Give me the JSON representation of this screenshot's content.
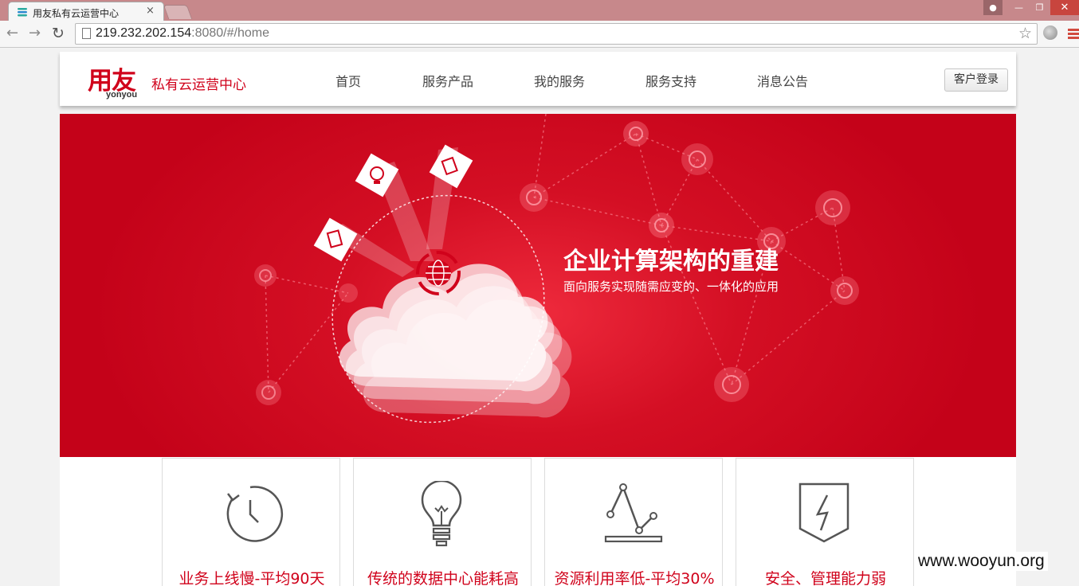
{
  "browser": {
    "tab_title": "用友私有云运营中心",
    "tab_close": "×",
    "url_host": "219.232.202.154",
    "url_rest": ":8080/#/home",
    "icons": {
      "back": "arrow-left-icon",
      "forward": "arrow-right-icon",
      "reload": "reload-icon",
      "star": "star-icon"
    }
  },
  "header": {
    "logo_text": "用友",
    "logo_sub": "yonyou",
    "logo_center": "私有云运营中心",
    "nav": [
      {
        "label": "首页"
      },
      {
        "label": "服务产品"
      },
      {
        "label": "我的服务"
      },
      {
        "label": "服务支持"
      },
      {
        "label": "消息公告"
      }
    ],
    "login_label": "客户登录"
  },
  "banner": {
    "title": "企业计算架构的重建",
    "subtitle": "面向服务实现随需应变的、一体化的应用",
    "accent_color": "#c40219"
  },
  "features": [
    {
      "label": "业务上线慢-平均90天",
      "icon": "clock-icon"
    },
    {
      "label": "传统的数据中心能耗高",
      "icon": "lightbulb-icon"
    },
    {
      "label": "资源利用率低-平均30%",
      "icon": "line-chart-icon"
    },
    {
      "label": "安全、管理能力弱",
      "icon": "shield-bolt-icon"
    }
  ],
  "watermark": "www.wooyun.org"
}
